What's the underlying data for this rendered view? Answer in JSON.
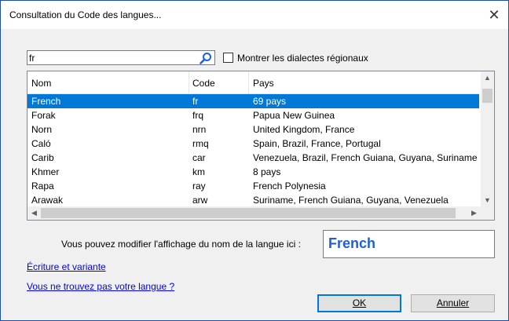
{
  "window": {
    "title": "Consultation du Code des langues...",
    "close_glyph": "✕"
  },
  "search": {
    "value": "fr",
    "placeholder": ""
  },
  "regional": {
    "label": "Montrer les dialectes régionaux",
    "checked": false
  },
  "list": {
    "columns": {
      "name": "Nom",
      "code": "Code",
      "country": "Pays"
    },
    "rows": [
      {
        "name": "French",
        "code": "fr",
        "country": "69 pays",
        "selected": true
      },
      {
        "name": "Forak",
        "code": "frq",
        "country": "Papua New Guinea"
      },
      {
        "name": "Norn",
        "code": "nrn",
        "country": "United Kingdom, France"
      },
      {
        "name": "Caló",
        "code": "rmq",
        "country": "Spain, Brazil, France, Portugal"
      },
      {
        "name": "Carib",
        "code": "car",
        "country": "Venezuela, Brazil, French Guiana, Guyana, Suriname"
      },
      {
        "name": "Khmer",
        "code": "km",
        "country": "8 pays"
      },
      {
        "name": "Rapa",
        "code": "ray",
        "country": "French Polynesia"
      },
      {
        "name": "Arawak",
        "code": "arw",
        "country": "Suriname, French Guiana, Guyana, Venezuela"
      }
    ]
  },
  "display": {
    "label": "Vous pouvez modifier l'affichage du nom de la langue ici :",
    "value": "French"
  },
  "links": {
    "script_variant": "Écriture et variante",
    "not_found": "Vous ne trouvez pas votre langue ?"
  },
  "buttons": {
    "ok": "OK",
    "cancel": "Annuler"
  },
  "colors": {
    "accent": "#0078d7",
    "display_text": "#1e5fd6",
    "link": "#0000ee"
  }
}
